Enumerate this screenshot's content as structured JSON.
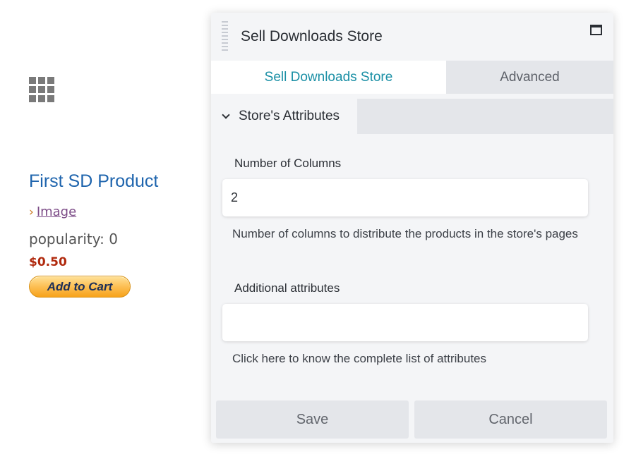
{
  "product": {
    "title": "First SD Product",
    "image_link": "Image",
    "popularity": "popularity: 0",
    "price": "$0.50",
    "add_to_cart": "Add to Cart"
  },
  "panel": {
    "title": "Sell Downloads Store",
    "tabs": [
      {
        "label": "Sell Downloads Store",
        "active": true
      },
      {
        "label": "Advanced",
        "active": false
      }
    ],
    "section": {
      "label": "Store's Attributes"
    },
    "fields": [
      {
        "label": "Number of Columns",
        "value": "2",
        "help": "Number of columns to distribute the products in the store's pages"
      },
      {
        "label": "Additional attributes",
        "value": "",
        "help": "Click here to know the complete list of attributes"
      }
    ],
    "buttons": {
      "save": "Save",
      "cancel": "Cancel"
    }
  },
  "icons": {
    "grid": "grid-icon",
    "drag": "drag-handle-icon",
    "maximize": "maximize-icon",
    "chevron": "chevron-down-icon",
    "link_bullet": "chevron-right-icon"
  },
  "colors": {
    "accent": "#1a8fa5",
    "product_title": "#1e64ad",
    "price": "#b0290d"
  }
}
